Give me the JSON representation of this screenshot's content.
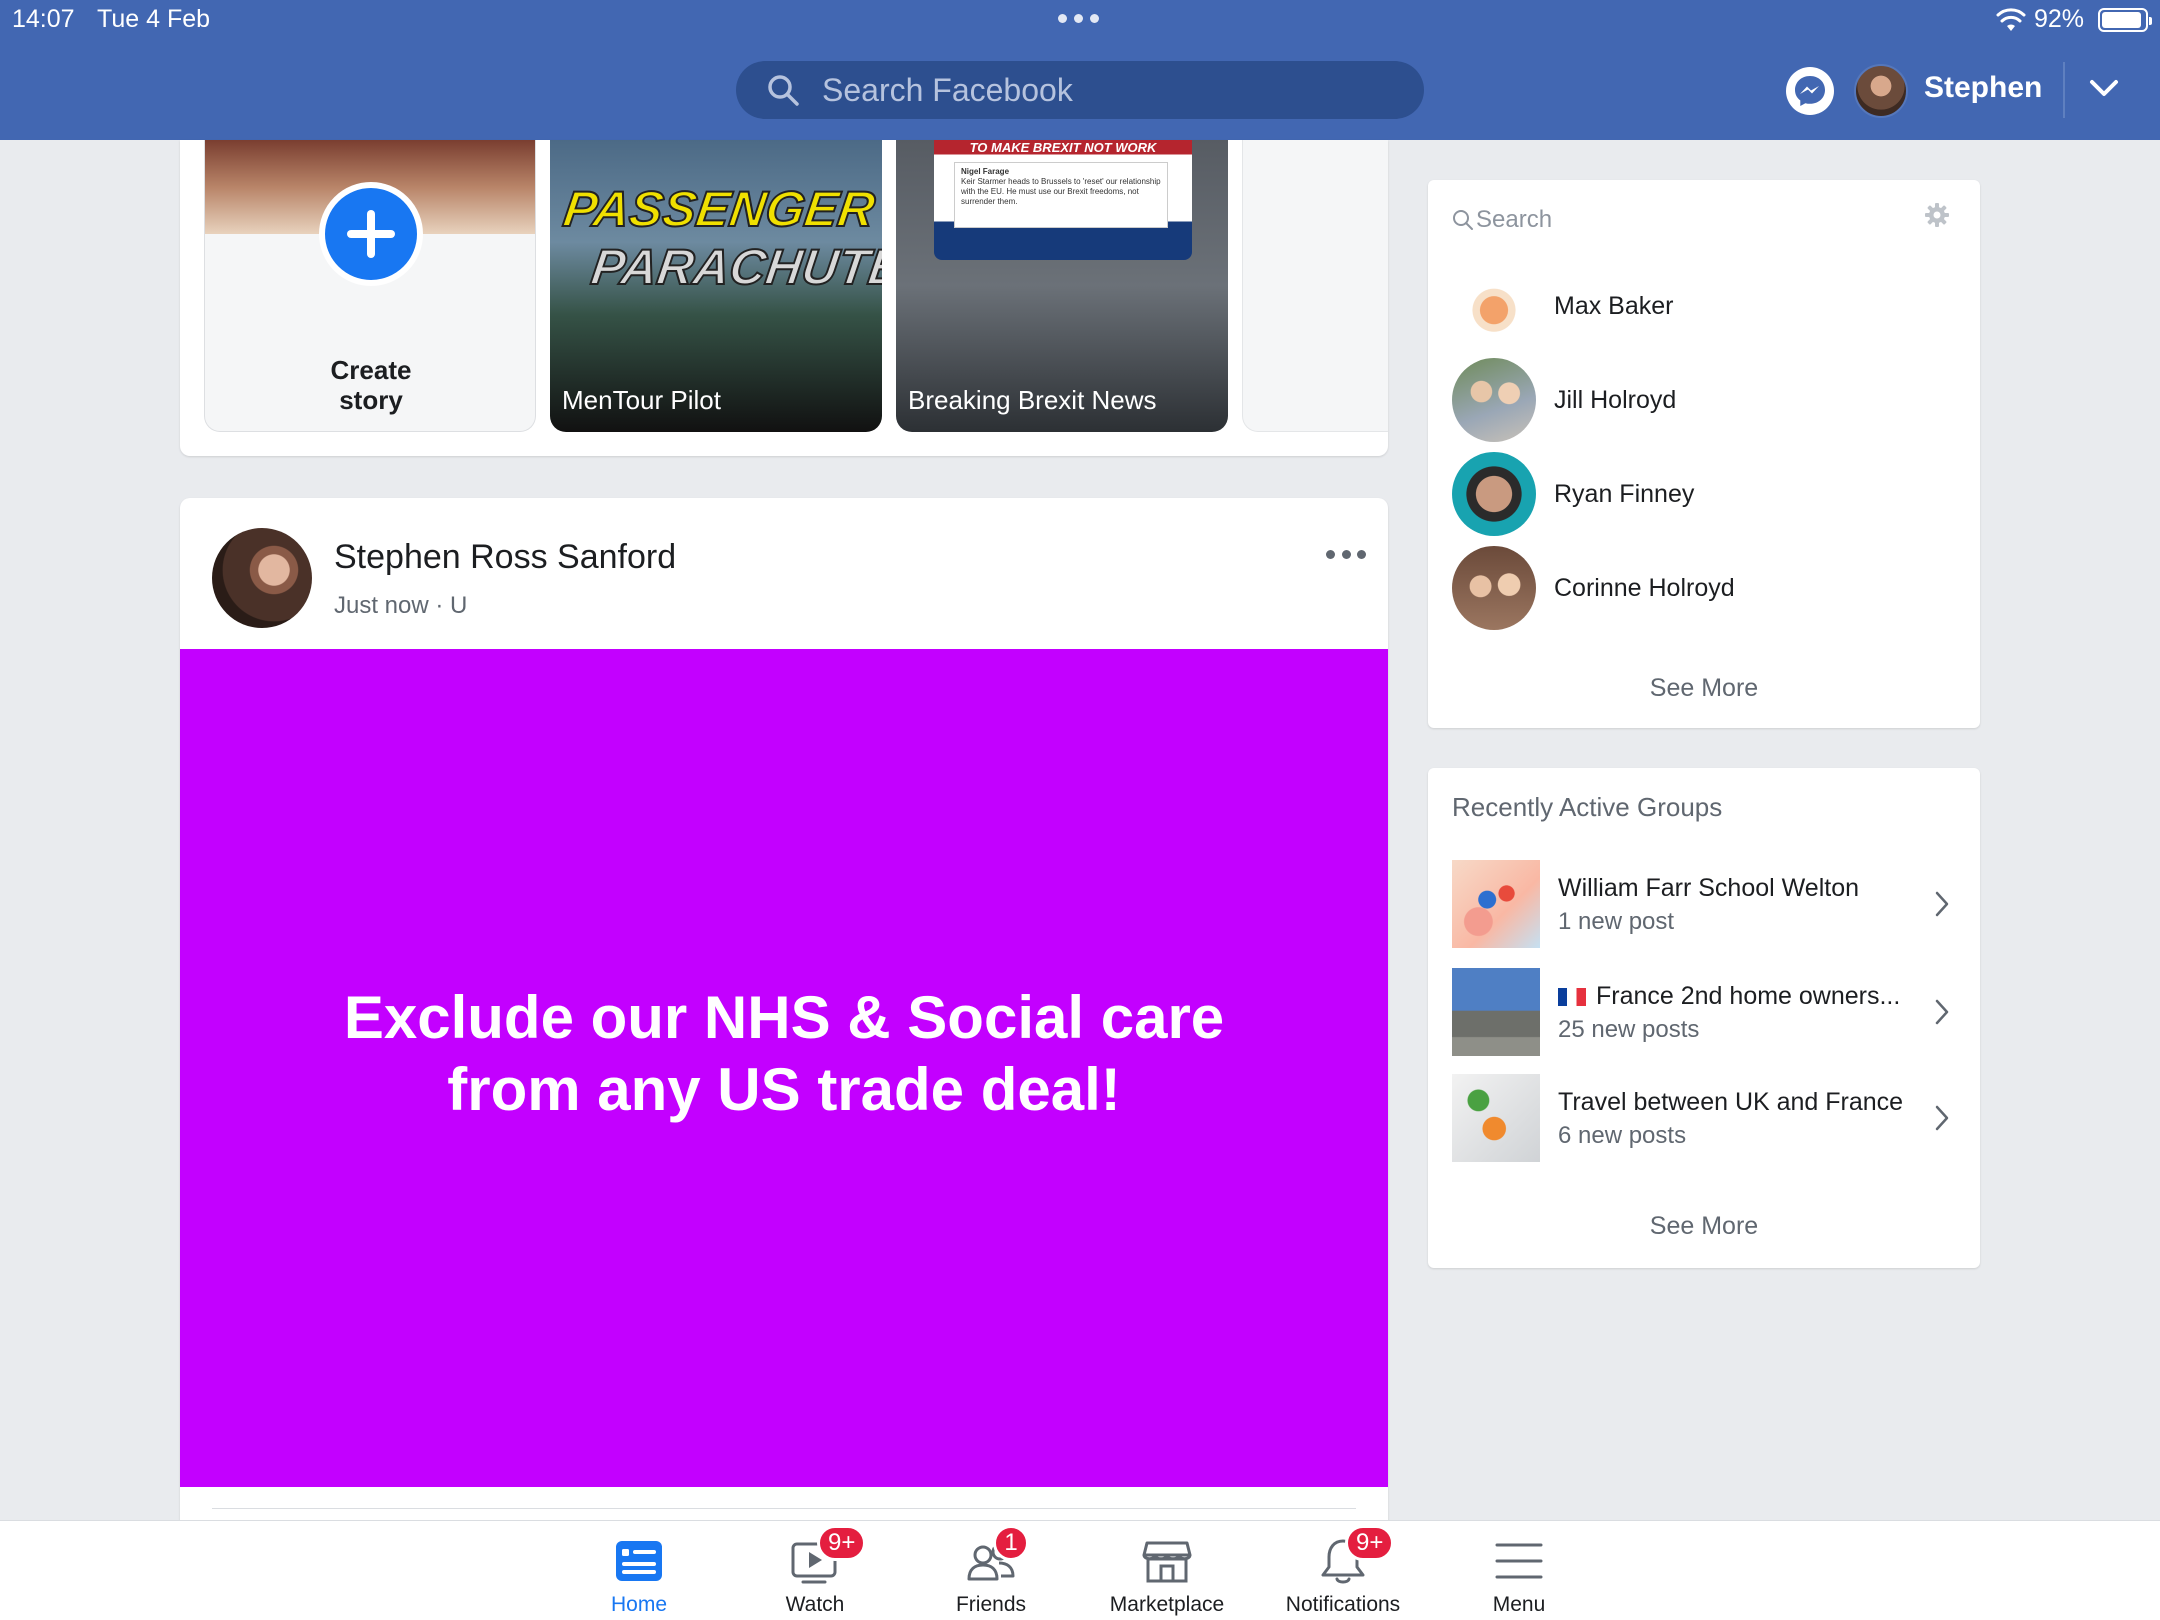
{
  "status_bar": {
    "time": "14:07",
    "date": "Tue 4 Feb",
    "battery_percent": "92%",
    "battery_level": 0.92
  },
  "header": {
    "search_placeholder": "Search Facebook",
    "user_name": "Stephen"
  },
  "stories": {
    "create_label_line1": "Create",
    "create_label_line2": "story",
    "items": [
      {
        "name": "MenTour Pilot",
        "image_text_1": "PASSENGER",
        "image_text_2": "PARACHUTES!"
      },
      {
        "name": "Breaking Brexit News",
        "image_headline": "TO MAKE BREXIT NOT WORK",
        "tweet_author": "Nigel Farage",
        "tweet_text": "Keir Starmer heads to Brussels to 'reset' our relationship with the EU. He must use our Brexit freedoms, not surrender them."
      }
    ]
  },
  "post": {
    "author": "Stephen Ross Sanford",
    "meta": "Just now · U",
    "text": "Exclude our NHS & Social care from any US trade deal!",
    "background_color": "#c300ff"
  },
  "contacts": {
    "search_placeholder": "Search",
    "items": [
      {
        "name": "Max Baker"
      },
      {
        "name": "Jill Holroyd"
      },
      {
        "name": "Ryan Finney"
      },
      {
        "name": "Corinne Holroyd"
      }
    ],
    "see_more": "See More"
  },
  "groups": {
    "title": "Recently Active Groups",
    "items": [
      {
        "name": "William Farr School Welton",
        "count": "1 new post"
      },
      {
        "name": "France 2nd home owners...",
        "count": "25 new posts"
      },
      {
        "name": "Travel between UK and France",
        "count": "6 new posts"
      }
    ],
    "see_more": "See More"
  },
  "tabbar": {
    "items": [
      {
        "label": "Home",
        "badge": ""
      },
      {
        "label": "Watch",
        "badge": "9+"
      },
      {
        "label": "Friends",
        "badge": "1"
      },
      {
        "label": "Marketplace",
        "badge": ""
      },
      {
        "label": "Notifications",
        "badge": "9+"
      },
      {
        "label": "Menu",
        "badge": ""
      }
    ]
  },
  "colors": {
    "brand_blue": "#4267b2",
    "accent_blue": "#1877f2",
    "badge_red": "#e41e3f"
  }
}
